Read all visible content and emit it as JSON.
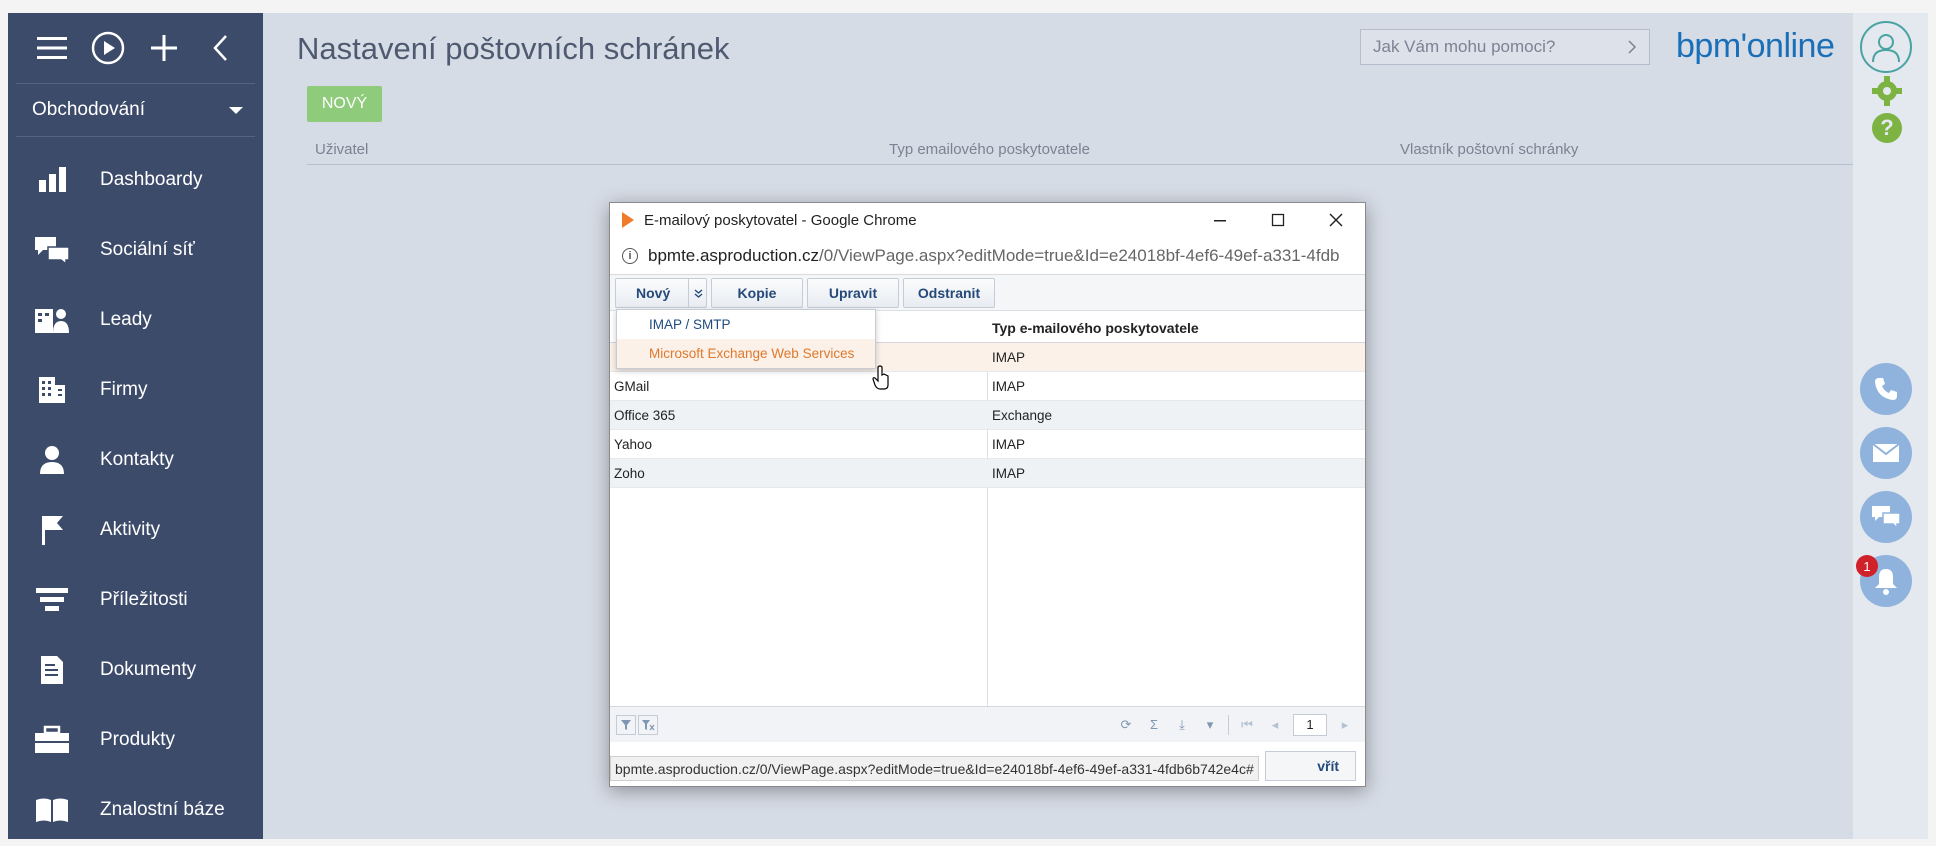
{
  "sidebar": {
    "section": "Obchodování",
    "items": [
      {
        "label": "Dashboardy",
        "icon": "bar-chart-icon"
      },
      {
        "label": "Sociální síť",
        "icon": "chat-bubbles-icon"
      },
      {
        "label": "Leady",
        "icon": "leads-icon"
      },
      {
        "label": "Firmy",
        "icon": "building-icon"
      },
      {
        "label": "Kontakty",
        "icon": "person-icon"
      },
      {
        "label": "Aktivity",
        "icon": "flag-icon"
      },
      {
        "label": "Příležitosti",
        "icon": "funnel-icon"
      },
      {
        "label": "Dokumenty",
        "icon": "document-icon"
      },
      {
        "label": "Produkty",
        "icon": "briefcase-icon"
      },
      {
        "label": "Znalostní báze",
        "icon": "book-icon"
      }
    ]
  },
  "header": {
    "title": "Nastavení poštovních schránek",
    "help_placeholder": "Jak Vám mohu pomoci?",
    "logo": "bpm'online"
  },
  "main": {
    "new_button": "NOVÝ",
    "columns": [
      "Uživatel",
      "Typ emailového poskytovatele",
      "Vlastník poštovní schránky"
    ]
  },
  "rightbar": {
    "notification_count": "1"
  },
  "popup": {
    "window_title": "E-mailový poskytovatel - Google Chrome",
    "url_host": "bpmte.asproduction.cz",
    "url_path": "/0/ViewPage.aspx?editMode=true&Id=e24018bf-4ef6-49ef-a331-4fdb",
    "toolbar": {
      "new": "Nový",
      "copy": "Kopie",
      "edit": "Upravit",
      "delete": "Odstranit"
    },
    "dropdown": [
      "IMAP / SMTP",
      "Microsoft Exchange Web Services"
    ],
    "grid_header_type": "Typ e-mailového poskytovatele",
    "rows": [
      {
        "name": "",
        "type": "IMAP"
      },
      {
        "name": "GMail",
        "type": "IMAP"
      },
      {
        "name": "Office 365",
        "type": "Exchange"
      },
      {
        "name": "Yahoo",
        "type": "IMAP"
      },
      {
        "name": "Zoho",
        "type": "IMAP"
      }
    ],
    "page": "1",
    "close_label": "vřít",
    "status_url": "bpmte.asproduction.cz/0/ViewPage.aspx?editMode=true&Id=e24018bf-4ef6-49ef-a331-4fdb6b742e4c#"
  }
}
